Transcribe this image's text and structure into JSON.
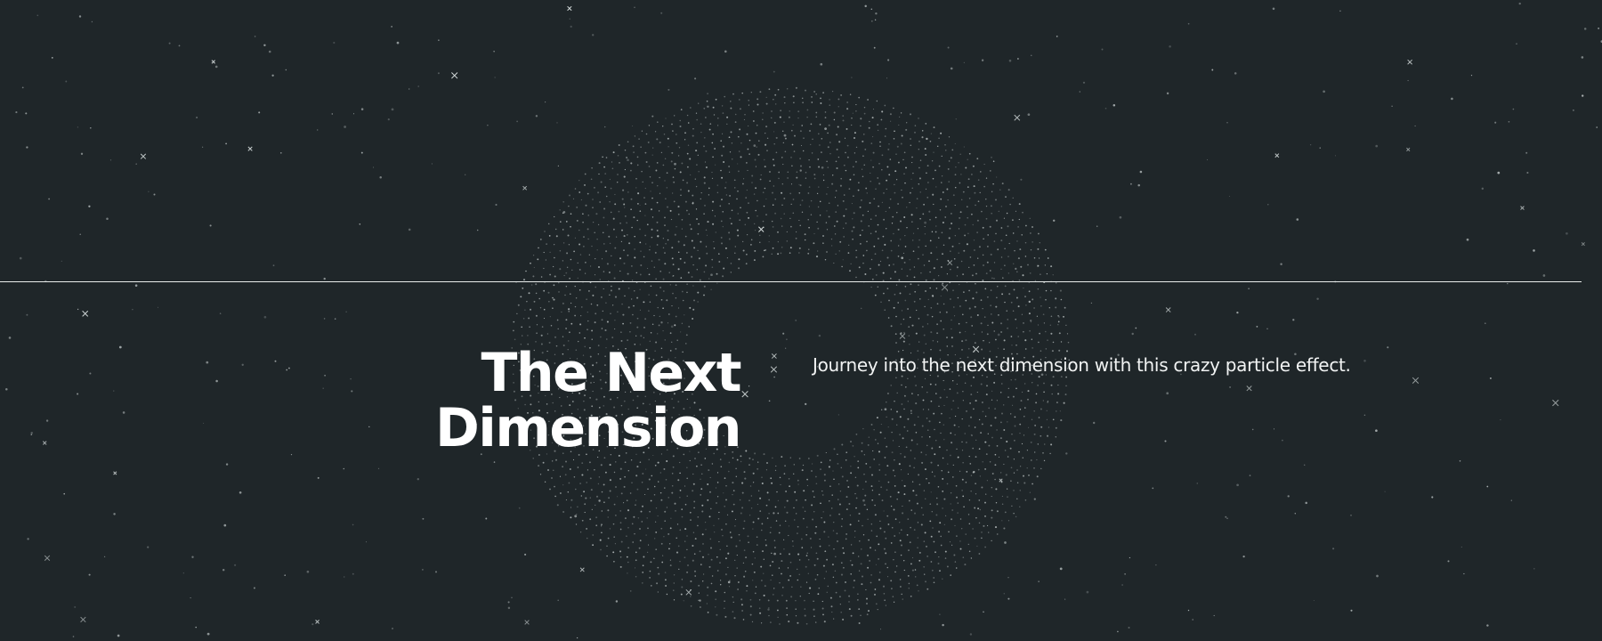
{
  "hero": {
    "title_line1": "The Next",
    "title_line2": "Dimension",
    "tagline": "Journey into the next dimension with this crazy particle effect."
  },
  "theme": {
    "background": "#1f2629",
    "text": "#ffffff",
    "particle": "#dfe6e6",
    "divider": "#e9ecec"
  }
}
